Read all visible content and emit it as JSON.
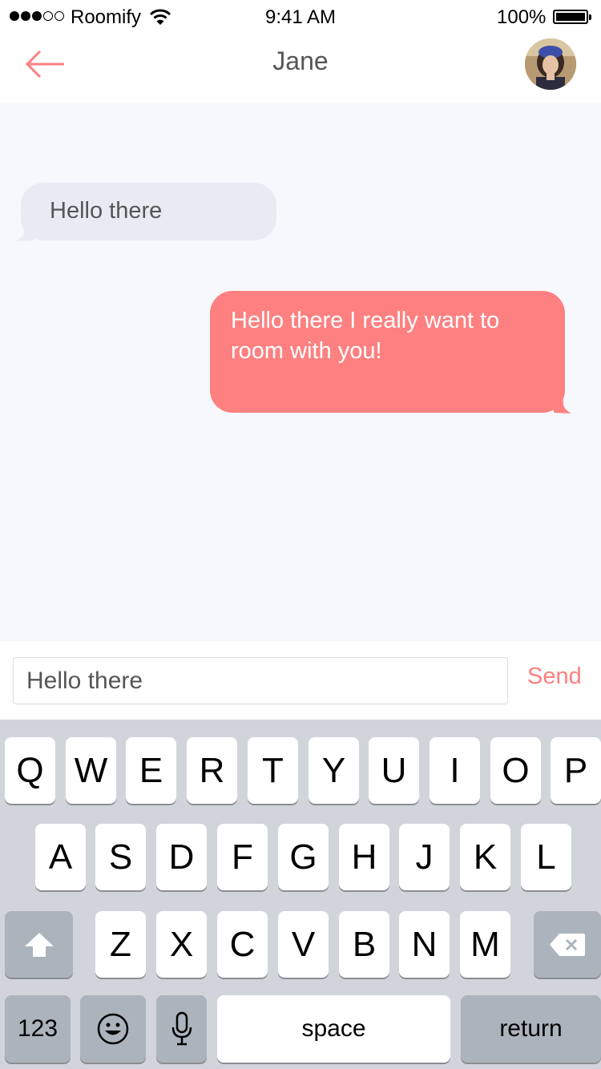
{
  "status_bar": {
    "carrier": "Roomify",
    "time": "9:41 AM",
    "battery": "100%"
  },
  "nav": {
    "title": "Jane",
    "icons": {
      "back": "arrow-left-icon",
      "avatar": "user-avatar"
    }
  },
  "messages": [
    {
      "direction": "incoming",
      "text": "Hello there"
    },
    {
      "direction": "outgoing",
      "text": "Hello there I really want to room with you!"
    }
  ],
  "composer": {
    "value": "Hello there",
    "send_label": "Send"
  },
  "keyboard": {
    "row1": [
      "Q",
      "W",
      "E",
      "R",
      "T",
      "Y",
      "U",
      "I",
      "O",
      "P"
    ],
    "row2": [
      "A",
      "S",
      "D",
      "F",
      "G",
      "H",
      "J",
      "K",
      "L"
    ],
    "row3": [
      "Z",
      "X",
      "C",
      "V",
      "B",
      "N",
      "M"
    ],
    "numbers_label": "123",
    "space_label": "space",
    "return_label": "return"
  },
  "colors": {
    "accent": "#fe8080",
    "incoming_bubble": "#e9ebf3",
    "background": "#f7f8fc",
    "keyboard_bg": "#d1d5db"
  }
}
